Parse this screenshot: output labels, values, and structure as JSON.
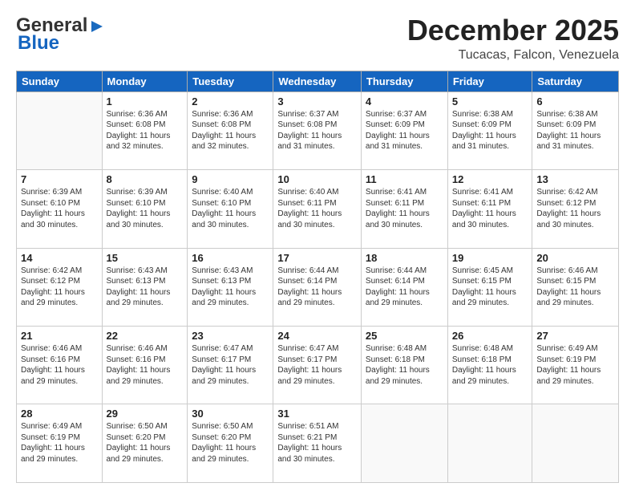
{
  "header": {
    "logo_line1": "General",
    "logo_line2": "Blue",
    "month": "December 2025",
    "location": "Tucacas, Falcon, Venezuela"
  },
  "days_of_week": [
    "Sunday",
    "Monday",
    "Tuesday",
    "Wednesday",
    "Thursday",
    "Friday",
    "Saturday"
  ],
  "weeks": [
    [
      {
        "day": "",
        "content": ""
      },
      {
        "day": "1",
        "content": "Sunrise: 6:36 AM\nSunset: 6:08 PM\nDaylight: 11 hours\nand 32 minutes."
      },
      {
        "day": "2",
        "content": "Sunrise: 6:36 AM\nSunset: 6:08 PM\nDaylight: 11 hours\nand 32 minutes."
      },
      {
        "day": "3",
        "content": "Sunrise: 6:37 AM\nSunset: 6:08 PM\nDaylight: 11 hours\nand 31 minutes."
      },
      {
        "day": "4",
        "content": "Sunrise: 6:37 AM\nSunset: 6:09 PM\nDaylight: 11 hours\nand 31 minutes."
      },
      {
        "day": "5",
        "content": "Sunrise: 6:38 AM\nSunset: 6:09 PM\nDaylight: 11 hours\nand 31 minutes."
      },
      {
        "day": "6",
        "content": "Sunrise: 6:38 AM\nSunset: 6:09 PM\nDaylight: 11 hours\nand 31 minutes."
      }
    ],
    [
      {
        "day": "7",
        "content": "Sunrise: 6:39 AM\nSunset: 6:10 PM\nDaylight: 11 hours\nand 30 minutes."
      },
      {
        "day": "8",
        "content": "Sunrise: 6:39 AM\nSunset: 6:10 PM\nDaylight: 11 hours\nand 30 minutes."
      },
      {
        "day": "9",
        "content": "Sunrise: 6:40 AM\nSunset: 6:10 PM\nDaylight: 11 hours\nand 30 minutes."
      },
      {
        "day": "10",
        "content": "Sunrise: 6:40 AM\nSunset: 6:11 PM\nDaylight: 11 hours\nand 30 minutes."
      },
      {
        "day": "11",
        "content": "Sunrise: 6:41 AM\nSunset: 6:11 PM\nDaylight: 11 hours\nand 30 minutes."
      },
      {
        "day": "12",
        "content": "Sunrise: 6:41 AM\nSunset: 6:11 PM\nDaylight: 11 hours\nand 30 minutes."
      },
      {
        "day": "13",
        "content": "Sunrise: 6:42 AM\nSunset: 6:12 PM\nDaylight: 11 hours\nand 30 minutes."
      }
    ],
    [
      {
        "day": "14",
        "content": "Sunrise: 6:42 AM\nSunset: 6:12 PM\nDaylight: 11 hours\nand 29 minutes."
      },
      {
        "day": "15",
        "content": "Sunrise: 6:43 AM\nSunset: 6:13 PM\nDaylight: 11 hours\nand 29 minutes."
      },
      {
        "day": "16",
        "content": "Sunrise: 6:43 AM\nSunset: 6:13 PM\nDaylight: 11 hours\nand 29 minutes."
      },
      {
        "day": "17",
        "content": "Sunrise: 6:44 AM\nSunset: 6:14 PM\nDaylight: 11 hours\nand 29 minutes."
      },
      {
        "day": "18",
        "content": "Sunrise: 6:44 AM\nSunset: 6:14 PM\nDaylight: 11 hours\nand 29 minutes."
      },
      {
        "day": "19",
        "content": "Sunrise: 6:45 AM\nSunset: 6:15 PM\nDaylight: 11 hours\nand 29 minutes."
      },
      {
        "day": "20",
        "content": "Sunrise: 6:46 AM\nSunset: 6:15 PM\nDaylight: 11 hours\nand 29 minutes."
      }
    ],
    [
      {
        "day": "21",
        "content": "Sunrise: 6:46 AM\nSunset: 6:16 PM\nDaylight: 11 hours\nand 29 minutes."
      },
      {
        "day": "22",
        "content": "Sunrise: 6:46 AM\nSunset: 6:16 PM\nDaylight: 11 hours\nand 29 minutes."
      },
      {
        "day": "23",
        "content": "Sunrise: 6:47 AM\nSunset: 6:17 PM\nDaylight: 11 hours\nand 29 minutes."
      },
      {
        "day": "24",
        "content": "Sunrise: 6:47 AM\nSunset: 6:17 PM\nDaylight: 11 hours\nand 29 minutes."
      },
      {
        "day": "25",
        "content": "Sunrise: 6:48 AM\nSunset: 6:18 PM\nDaylight: 11 hours\nand 29 minutes."
      },
      {
        "day": "26",
        "content": "Sunrise: 6:48 AM\nSunset: 6:18 PM\nDaylight: 11 hours\nand 29 minutes."
      },
      {
        "day": "27",
        "content": "Sunrise: 6:49 AM\nSunset: 6:19 PM\nDaylight: 11 hours\nand 29 minutes."
      }
    ],
    [
      {
        "day": "28",
        "content": "Sunrise: 6:49 AM\nSunset: 6:19 PM\nDaylight: 11 hours\nand 29 minutes."
      },
      {
        "day": "29",
        "content": "Sunrise: 6:50 AM\nSunset: 6:20 PM\nDaylight: 11 hours\nand 29 minutes."
      },
      {
        "day": "30",
        "content": "Sunrise: 6:50 AM\nSunset: 6:20 PM\nDaylight: 11 hours\nand 29 minutes."
      },
      {
        "day": "31",
        "content": "Sunrise: 6:51 AM\nSunset: 6:21 PM\nDaylight: 11 hours\nand 30 minutes."
      },
      {
        "day": "",
        "content": ""
      },
      {
        "day": "",
        "content": ""
      },
      {
        "day": "",
        "content": ""
      }
    ]
  ]
}
